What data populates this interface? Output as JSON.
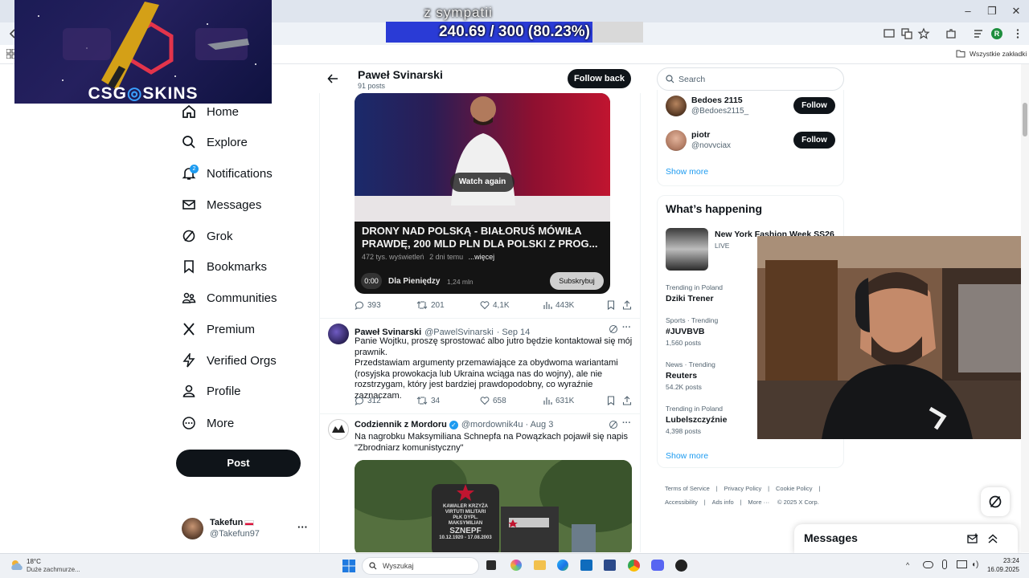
{
  "browser": {
    "window_controls": [
      "–",
      "❐",
      "✕"
    ],
    "bookmarks_label": "Wszystkie zakładki",
    "profile_initial": "R"
  },
  "stream": {
    "subtitle": "z sympatii",
    "progress_text": "240.69 / 300 (80.23%)",
    "progress_fraction": 0.8023,
    "banner_logo": "CSG◎SKINS",
    "banner_left": "CSG",
    "banner_right": "SKINS"
  },
  "nav": {
    "notifications_badge": "2",
    "items": [
      "Home",
      "Explore",
      "Notifications",
      "Messages",
      "Grok",
      "Bookmarks",
      "Communities",
      "Premium",
      "Verified Orgs",
      "Profile",
      "More"
    ],
    "post_label": "Post"
  },
  "account": {
    "name": "Takefun",
    "handle": "@Takefun97",
    "more": "···"
  },
  "profile_header": {
    "name": "Paweł Svinarski",
    "posts": "91 posts",
    "follow_back": "Follow back"
  },
  "video": {
    "watch_again": "Watch again",
    "title": "DRONY NAD POLSKĄ - BIAŁORUŚ MÓWIŁA PRAWDĘ, 200 MLD PLN DLA POLSKI Z PROG...",
    "views": "472 tys. wyświetleń",
    "age": "2 dni temu",
    "more": "...więcej",
    "time": "0:00",
    "channel": "Dla Pieniędzy",
    "subs": "1,24 mln",
    "subscribe": "Subskrybuj",
    "stats": {
      "replies": "393",
      "reposts": "201",
      "likes": "4,1K",
      "views": "443K"
    }
  },
  "tweets": [
    {
      "name": "Paweł Svinarski",
      "handle": "@PawelSvinarski",
      "date": "· Sep 14",
      "text": [
        "Panie Wojtku, proszę sprostować albo jutro będzie kontaktował się mój",
        "prawnik.",
        "Przedstawiam argumenty przemawiające za obydwoma wariantami",
        "(rosyjska prowokacja lub Ukraina wciąga nas do wojny), ale nie",
        "rozstrzygam, który jest bardziej prawdopodobny, co wyraźnie zaznaczam."
      ],
      "stats": {
        "replies": "312",
        "reposts": "34",
        "likes": "658",
        "views": "631K"
      }
    },
    {
      "name": "Codziennik z Mordoru",
      "handle": "@mordownik4u",
      "date": "· Aug 3",
      "text": [
        "Na nagrobku Maksymiliana Schnepfa na Powązkach pojawił się napis",
        "\"Zbrodniarz komunistyczny\""
      ]
    }
  ],
  "tombstone": {
    "line1": "KAWALER KRZYŻA",
    "line2": "VIRTUTI MILITARI",
    "line3": "PŁK DYPL.",
    "line4": "MAKSYMILIAN",
    "line5": "SZNEPF",
    "line6": "10.12.1920 - 17.08.2003"
  },
  "search": {
    "placeholder": "Search"
  },
  "who_to_follow": {
    "users": [
      {
        "name": "Bedoes 2115",
        "handle": "@Bedoes2115_",
        "button": "Follow"
      },
      {
        "name": "piotr",
        "handle": "@novvciax",
        "button": "Follow"
      }
    ],
    "show_more": "Show more"
  },
  "whats_happening": {
    "title": "What’s happening",
    "event": {
      "title": "New York Fashion Week SS26",
      "status": "LIVE"
    },
    "trends": [
      {
        "context": "Trending in Poland",
        "title": "Dziki Trener",
        "count": ""
      },
      {
        "context": "Sports · Trending",
        "title": "#JUVBVB",
        "count": "1,560 posts"
      },
      {
        "context": "News · Trending",
        "title": "Reuters",
        "count": "54.2K posts"
      },
      {
        "context": "Trending in Poland",
        "title": "Lubelszczyźnie",
        "count": "4,398 posts"
      }
    ],
    "show_more": "Show more"
  },
  "footer": {
    "links": [
      "Terms of Service",
      "Privacy Policy",
      "Cookie Policy",
      "Accessibility",
      "Ads info",
      "More ···",
      "© 2025 X Corp."
    ],
    "separator": "|"
  },
  "messages_bar": {
    "title": "Messages"
  },
  "taskbar": {
    "weather_temp": "18°C",
    "weather_desc": "Duże zachmurze...",
    "search_placeholder": "Wyszukaj",
    "time": "23:24",
    "date": "16.09.2025"
  },
  "colors": {
    "x_black": "#0f1419",
    "x_gray": "#536471",
    "verified_blue": "#1d9bf0",
    "progress_blue": "#2a3bd6",
    "notification_blue": "#1d9bf0"
  }
}
